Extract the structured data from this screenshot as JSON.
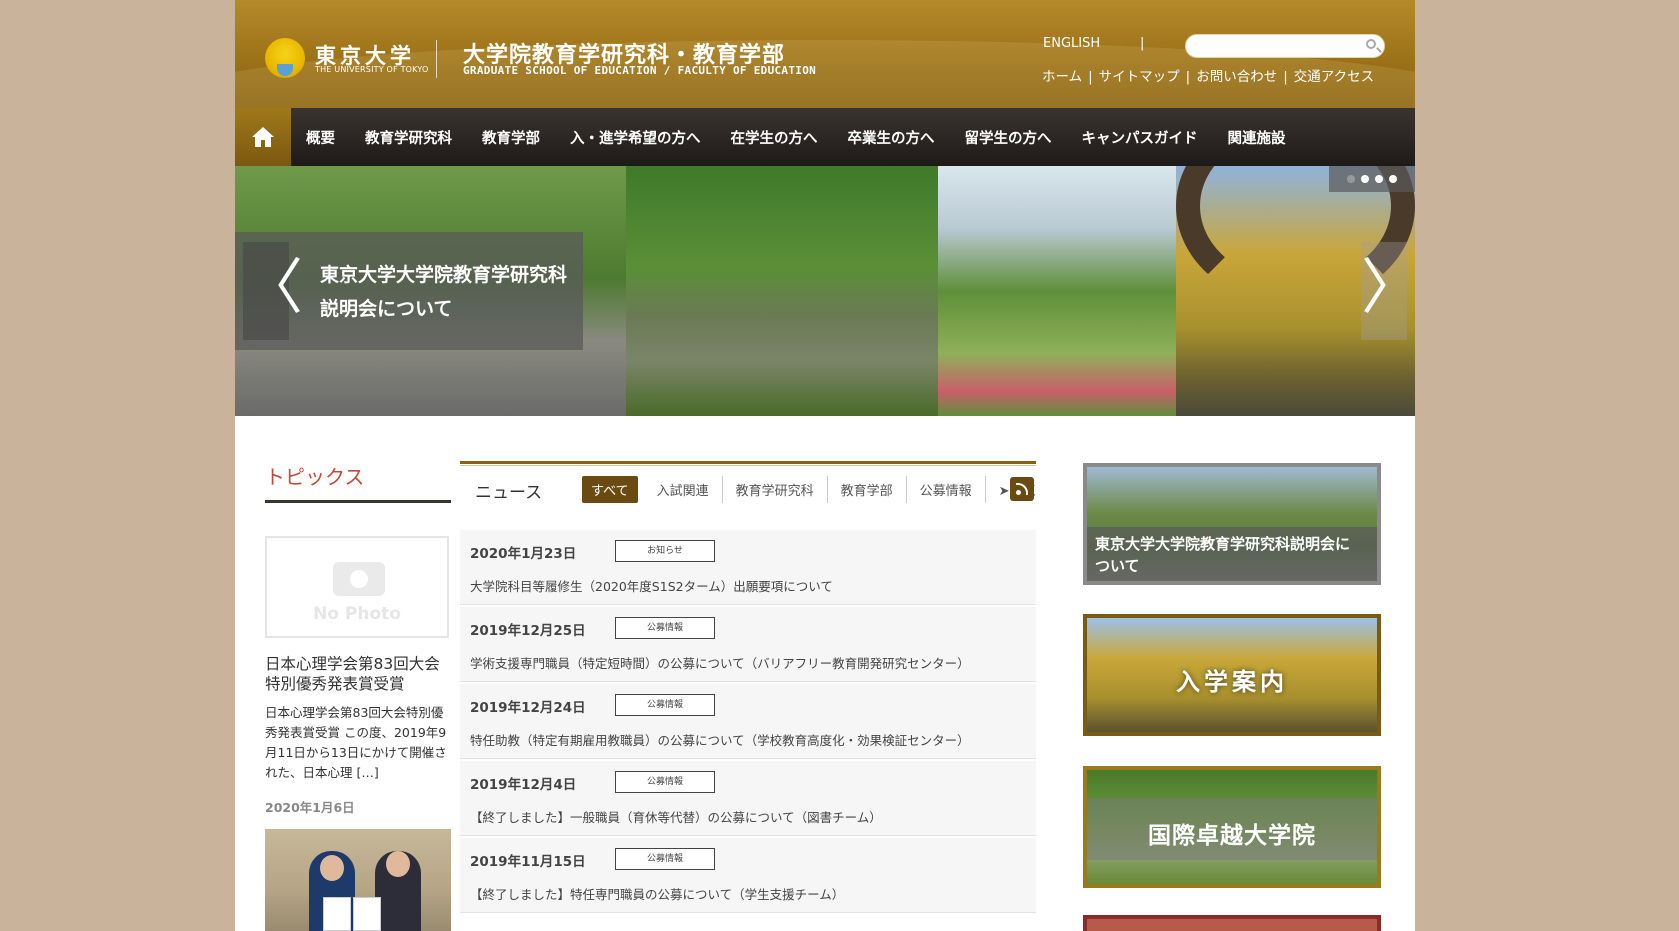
{
  "header": {
    "logo_jp": "東京大学",
    "logo_en": "THE UNIVERSITY OF TOKYO",
    "school_jp": "大学院教育学研究科・教育学部",
    "school_en": "GRADUATE SCHOOL OF EDUCATION / FACULTY OF EDUCATION",
    "english_link": "ENGLISH",
    "separator": "|",
    "search_placeholder": "",
    "util_links": [
      "ホーム",
      "サイトマップ",
      "お問い合わせ",
      "交通アクセス"
    ]
  },
  "nav": {
    "home_icon": "home-icon",
    "items": [
      "概要",
      "教育学研究科",
      "教育学部",
      "入・進学希望の方へ",
      "在学生の方へ",
      "卒業生の方へ",
      "留学生の方へ",
      "キャンパスガイド",
      "関連施設"
    ]
  },
  "slider": {
    "caption": "東京大学大学院教育学研究科説明会について",
    "prev_glyph": "〈",
    "next_glyph": "〉",
    "dot_count": 4,
    "active_dots": [
      2,
      3,
      4
    ]
  },
  "topics": {
    "title": "トピックス",
    "nophoto_text": "No Photo",
    "item_heading": "日本心理学会第83回大会特別優秀発表賞受賞",
    "item_body": "日本心理学会第83回大会特別優秀発表賞受賞 この度、2019年9月11日から13日にかけて開催された、日本心理 […]",
    "item_date": "2020年1月6日"
  },
  "news": {
    "title": "ニュース",
    "tabs": [
      "すべて",
      "入試関連",
      "教育学研究科",
      "教育学部",
      "公募情報",
      "➤一覧"
    ],
    "active_tab": "すべて",
    "rss_icon": "rss-icon",
    "items": [
      {
        "date": "2020年1月23日",
        "category": "お知らせ",
        "title": "大学院科目等履修生（2020年度S1S2ターム）出願要項について"
      },
      {
        "date": "2019年12月25日",
        "category": "公募情報",
        "title": "学術支援専門職員（特定短時間）の公募について（バリアフリー教育開発研究センター）"
      },
      {
        "date": "2019年12月24日",
        "category": "公募情報",
        "title": "特任助教（特定有期雇用教職員）の公募について（学校教育高度化・効果検証センター）"
      },
      {
        "date": "2019年12月4日",
        "category": "公募情報",
        "title": "【終了しました】一般職員（育休等代替）の公募について（図書チーム）"
      },
      {
        "date": "2019年11月15日",
        "category": "公募情報",
        "title": "【終了しました】特任専門職員の公募について（学生支援チーム）"
      }
    ]
  },
  "banners": {
    "briefing": "東京大学大学院教育学研究科説明会について",
    "admission": "入学案内",
    "global": "国際卓越大学院"
  },
  "colors": {
    "header_gold": "#9a7017",
    "nav_dark": "#1e1a18",
    "topics_red": "#c24a3a",
    "accent_brown": "#6b4a12",
    "background": "#c9b49b"
  }
}
